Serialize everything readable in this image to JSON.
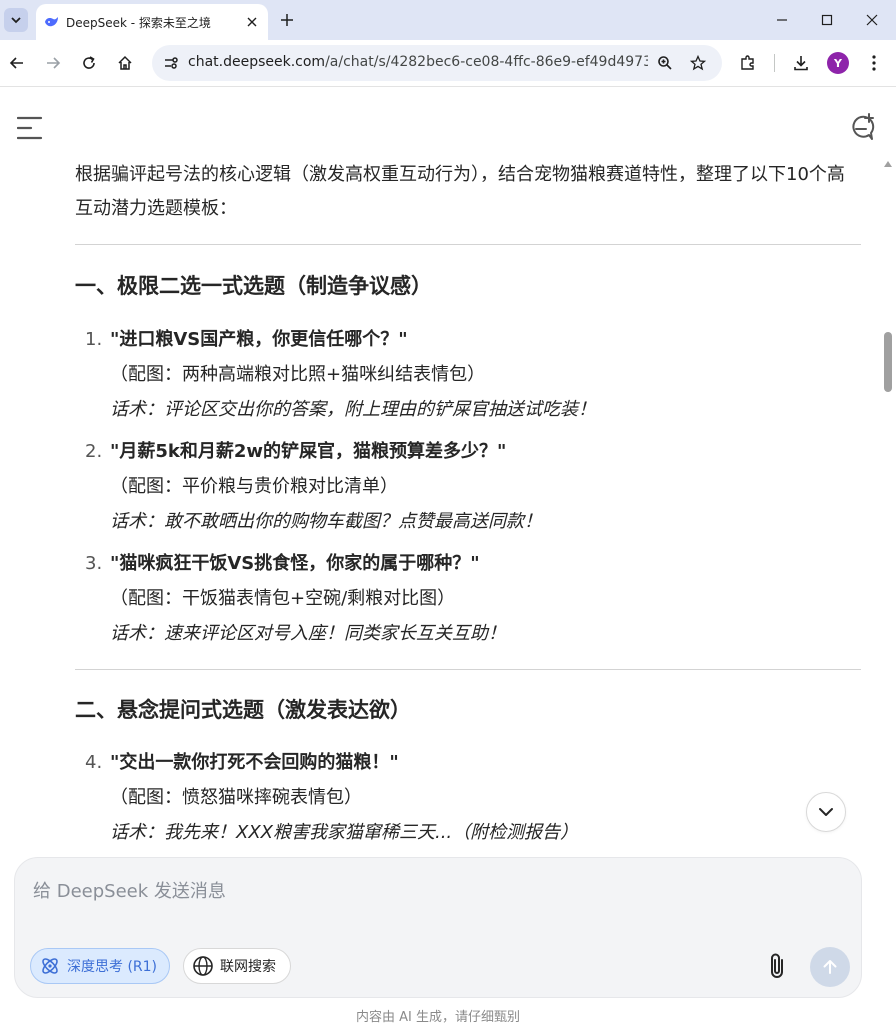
{
  "browser": {
    "tab_title": "DeepSeek - 探索未至之境",
    "url_domain": "chat.deepseek.com",
    "url_path": "/a/chat/s/4282bec6-ce08-4ffc-86e9-ef49d4973...",
    "profile_initial": "Y"
  },
  "content": {
    "intro": "根据骗评起号法的核心逻辑（激发高权重互动行为），结合宠物猫粮赛道特性，整理了以下10个高互动潜力选题模板：",
    "section1_heading": "一、极限二选一式选题（制造争议感）",
    "section2_heading": "二、悬念提问式选题（激发表达欲）",
    "items": [
      {
        "num": "1.",
        "title": "\"进口粮VS国产粮，你更信任哪个？\"",
        "picture": "（配图：两种高端粮对比照+猫咪纠结表情包）",
        "talk": "话术：评论区交出你的答案，附上理由的铲屎官抽送试吃装！"
      },
      {
        "num": "2.",
        "title": "\"月薪5k和月薪2w的铲屎官，猫粮预算差多少？\"",
        "picture": "（配图：平价粮与贵价粮对比清单）",
        "talk": "话术：敢不敢晒出你的购物车截图？点赞最高送同款！"
      },
      {
        "num": "3.",
        "title": "\"猫咪疯狂干饭VS挑食怪，你家的属于哪种？\"",
        "picture": "（配图：干饭猫表情包+空碗/剩粮对比图）",
        "talk": "话术：速来评论区对号入座！同类家长互关互助！"
      },
      {
        "num": "4.",
        "title": "\"交出一款你打死不会回购的猫粮！\"",
        "picture": "（配图：愤怒猫咪摔碗表情包）",
        "talk": "话术：我先来！XXX粮害我家猫窜稀三天...（附检测报告）"
      }
    ]
  },
  "composer": {
    "placeholder": "给 DeepSeek 发送消息",
    "deep_think_label": "深度思考 (R1)",
    "web_search_label": "联网搜索"
  },
  "footer": {
    "disclaimer": "内容由 AI 生成，请仔细甄别"
  },
  "colors": {
    "tabbar_bg": "#dfe5f5",
    "accent_blue": "#3d6fd6",
    "deep_think_bg": "#dbeafe",
    "send_button_bg": "#cfd9e8",
    "profile_bg": "#8e24aa"
  }
}
